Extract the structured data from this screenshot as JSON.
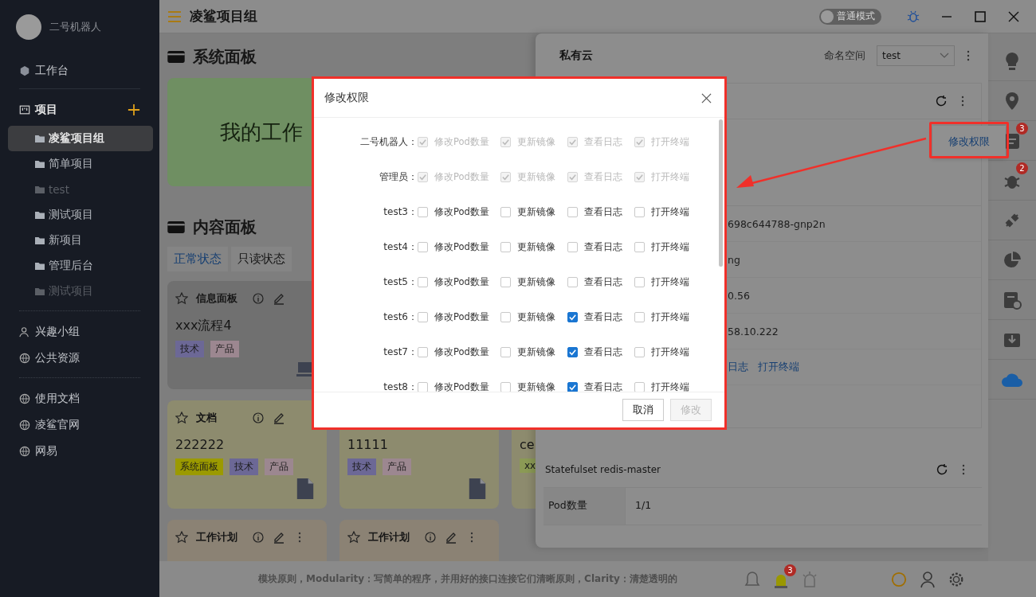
{
  "sidebar": {
    "user": "二号机器人",
    "workbench": "工作台",
    "projects_header": "项目",
    "projects": [
      {
        "name": "凌鲨项目组",
        "selected": true,
        "disabled": false
      },
      {
        "name": "简单项目",
        "selected": false,
        "disabled": false
      },
      {
        "name": "test",
        "selected": false,
        "disabled": true
      },
      {
        "name": "测试项目",
        "selected": false,
        "disabled": false
      },
      {
        "name": "新项目",
        "selected": false,
        "disabled": false
      },
      {
        "name": "管理后台",
        "selected": false,
        "disabled": false
      },
      {
        "name": "测试项目",
        "selected": false,
        "disabled": true
      }
    ],
    "groups": [
      {
        "label": "兴趣小组",
        "kind": "people"
      },
      {
        "label": "公共资源",
        "kind": "globe"
      }
    ],
    "links": [
      "使用文档",
      "凌鲨官网",
      "网易"
    ]
  },
  "topbar": {
    "title": "凌鲨项目组",
    "mode": {
      "label": "普通模式",
      "on": false
    }
  },
  "system_panel": {
    "title": "系统面板",
    "card": "我的工作"
  },
  "content_panel": {
    "title": "内容面板",
    "tabs": [
      {
        "label": "正常状态",
        "selected": true
      },
      {
        "label": "只读状态",
        "selected": false
      }
    ],
    "card_rows": [
      [
        {
          "kind": "info",
          "title": "信息面板",
          "body": "xxx流程4",
          "tags": [
            {
              "label": "技术",
              "color": "#6c6896"
            },
            {
              "label": "产品",
              "color": "#9c8790"
            }
          ]
        }
      ],
      [
        {
          "kind": "doc",
          "title": "文档",
          "body": "222222",
          "tags": [
            {
              "label": "系统面板",
              "color": "#9b9a00"
            },
            {
              "label": "技术",
              "color": "#6c6896"
            },
            {
              "label": "产品",
              "color": "#9c8790"
            }
          ]
        },
        {
          "kind": "doc",
          "body": "11111",
          "tags": [
            {
              "label": "技术",
              "color": "#6c6896"
            },
            {
              "label": "产品",
              "color": "#9c8790"
            }
          ]
        },
        {
          "kind": "doc",
          "body": "ce",
          "tags": [
            {
              "label": "xx",
              "color": "#8b9a55"
            }
          ]
        }
      ],
      [
        {
          "kind": "plan",
          "title": "工作计划"
        },
        {
          "kind": "plan",
          "title": "工作计划"
        }
      ]
    ]
  },
  "status_bar": {
    "ticker": "模块原则，Modularity：写简单的程序，并用好的接口连接它们清晰原则，Clarity：清楚透明的",
    "alarm_badge": "3"
  },
  "drawer": {
    "title": "私有云",
    "namespace_label": "命名空间",
    "namespace": "test",
    "menu_item": "修改权限",
    "fragments": [
      "698c644788-gnp2n",
      "ng",
      "0.56",
      "58.10.222"
    ],
    "links": [
      "日志",
      "打开终端"
    ],
    "statefulset": {
      "title": "Statefulset redis-master",
      "rows": [
        {
          "name": "Pod数量",
          "value": "1/1"
        }
      ]
    }
  },
  "right_rail": [
    {
      "kind": "bulb",
      "selected": false
    },
    {
      "kind": "pin",
      "selected": false
    },
    {
      "kind": "doc",
      "badge": "3",
      "selected": false
    },
    {
      "kind": "bug",
      "badge": "2",
      "selected": false
    },
    {
      "kind": "plug",
      "selected": false
    },
    {
      "kind": "pie",
      "selected": false
    },
    {
      "kind": "clockdoc",
      "selected": false
    },
    {
      "kind": "download",
      "selected": false
    },
    {
      "kind": "cloud",
      "selected": true
    }
  ],
  "modal": {
    "title": "修改权限",
    "buttons": [
      {
        "label": "取消",
        "disabled": false
      },
      {
        "label": "修改",
        "disabled": true
      }
    ],
    "rows": [
      {
        "member": "二号机器人：",
        "perms": [
          {
            "label": "修改Pod数量",
            "checked": true,
            "disabled": true
          },
          {
            "label": "更新镜像",
            "checked": true,
            "disabled": true
          },
          {
            "label": "查看日志",
            "checked": true,
            "disabled": true
          },
          {
            "label": "打开终端",
            "checked": true,
            "disabled": true
          }
        ]
      },
      {
        "member": "管理员：",
        "perms": [
          {
            "label": "修改Pod数量",
            "checked": true,
            "disabled": true
          },
          {
            "label": "更新镜像",
            "checked": true,
            "disabled": true
          },
          {
            "label": "查看日志",
            "checked": true,
            "disabled": true
          },
          {
            "label": "打开终端",
            "checked": true,
            "disabled": true
          }
        ]
      },
      {
        "member": "test3：",
        "perms": [
          {
            "label": "修改Pod数量",
            "checked": false,
            "disabled": false
          },
          {
            "label": "更新镜像",
            "checked": false,
            "disabled": false
          },
          {
            "label": "查看日志",
            "checked": false,
            "disabled": false
          },
          {
            "label": "打开终端",
            "checked": false,
            "disabled": false
          }
        ]
      },
      {
        "member": "test4：",
        "perms": [
          {
            "label": "修改Pod数量",
            "checked": false,
            "disabled": false
          },
          {
            "label": "更新镜像",
            "checked": false,
            "disabled": false
          },
          {
            "label": "查看日志",
            "checked": false,
            "disabled": false
          },
          {
            "label": "打开终端",
            "checked": false,
            "disabled": false
          }
        ]
      },
      {
        "member": "test5：",
        "perms": [
          {
            "label": "修改Pod数量",
            "checked": false,
            "disabled": false
          },
          {
            "label": "更新镜像",
            "checked": false,
            "disabled": false
          },
          {
            "label": "查看日志",
            "checked": false,
            "disabled": false
          },
          {
            "label": "打开终端",
            "checked": false,
            "disabled": false
          }
        ]
      },
      {
        "member": "test6：",
        "perms": [
          {
            "label": "修改Pod数量",
            "checked": false,
            "disabled": false
          },
          {
            "label": "更新镜像",
            "checked": false,
            "disabled": false
          },
          {
            "label": "查看日志",
            "checked": true,
            "disabled": false
          },
          {
            "label": "打开终端",
            "checked": false,
            "disabled": false
          }
        ]
      },
      {
        "member": "test7：",
        "perms": [
          {
            "label": "修改Pod数量",
            "checked": false,
            "disabled": false
          },
          {
            "label": "更新镜像",
            "checked": false,
            "disabled": false
          },
          {
            "label": "查看日志",
            "checked": true,
            "disabled": false
          },
          {
            "label": "打开终端",
            "checked": false,
            "disabled": false
          }
        ]
      },
      {
        "member": "test8：",
        "perms": [
          {
            "label": "修改Pod数量",
            "checked": false,
            "disabled": false
          },
          {
            "label": "更新镜像",
            "checked": false,
            "disabled": false
          },
          {
            "label": "查看日志",
            "checked": true,
            "disabled": false
          },
          {
            "label": "打开终端",
            "checked": false,
            "disabled": false
          }
        ]
      }
    ]
  }
}
